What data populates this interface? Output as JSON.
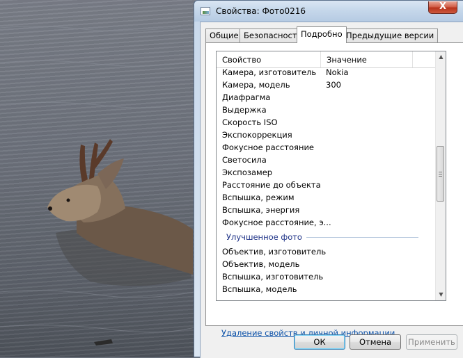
{
  "window": {
    "title": "Свойства: Фото0216",
    "close_glyph": "X"
  },
  "tabs": [
    {
      "label": "Общие",
      "active": false
    },
    {
      "label": "Безопасность",
      "active": false
    },
    {
      "label": "Подробно",
      "active": true
    },
    {
      "label": "Предыдущие версии",
      "active": false
    }
  ],
  "table": {
    "columns": [
      "Свойство",
      "Значение"
    ],
    "rows": [
      {
        "property": "Камера, изготовитель",
        "value": "Nokia"
      },
      {
        "property": "Камера, модель",
        "value": "300"
      },
      {
        "property": "Диафрагма",
        "value": ""
      },
      {
        "property": "Выдержка",
        "value": ""
      },
      {
        "property": "Скорость ISO",
        "value": ""
      },
      {
        "property": "Экспокоррекция",
        "value": ""
      },
      {
        "property": "Фокусное расстояние",
        "value": ""
      },
      {
        "property": "Светосила",
        "value": ""
      },
      {
        "property": "Экспозамер",
        "value": ""
      },
      {
        "property": "Расстояние до объекта",
        "value": ""
      },
      {
        "property": "Вспышка, режим",
        "value": ""
      },
      {
        "property": "Вспышка, энергия",
        "value": ""
      },
      {
        "property": "Фокусное расстояние, э...",
        "value": ""
      }
    ],
    "group_label": "Улучшенное фото",
    "group_rows": [
      {
        "property": "Объектив, изготовитель",
        "value": ""
      },
      {
        "property": "Объектив, модель",
        "value": ""
      },
      {
        "property": "Вспышка, изготовитель",
        "value": ""
      },
      {
        "property": "Вспышка, модель",
        "value": ""
      }
    ]
  },
  "remove_link": "Удаление свойств и личной информации",
  "buttons": {
    "ok": "ОК",
    "cancel": "Отмена",
    "apply": "Применить"
  },
  "colors": {
    "link": "#0a50a8",
    "group_header": "#1e3287",
    "close_button": "#c8442a"
  }
}
